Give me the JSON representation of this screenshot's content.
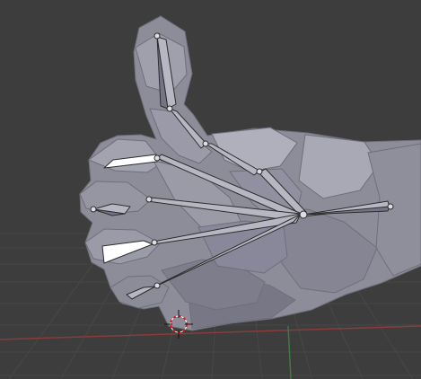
{
  "viewport": {
    "background": "#3d3d3d",
    "grid_color": "#474747",
    "x_axis_color": "#8a3b3b",
    "y_axis_color": "#3f7a3f"
  },
  "scene": {
    "mesh_color": "#8d8d99",
    "mesh_edge_color": "#6f6f7c",
    "bone_color": "#b7b7c4",
    "bone_shadow_color": "#747487",
    "bone_edge_color": "#2d2d2d",
    "cursor_outline_color": "#d51f1f",
    "cursor_fill_color": "#ffffff"
  },
  "icons": {
    "cursor": "3d-cursor-icon",
    "hand_mesh": "hand-mesh-icon",
    "armature": "bone-icon"
  }
}
